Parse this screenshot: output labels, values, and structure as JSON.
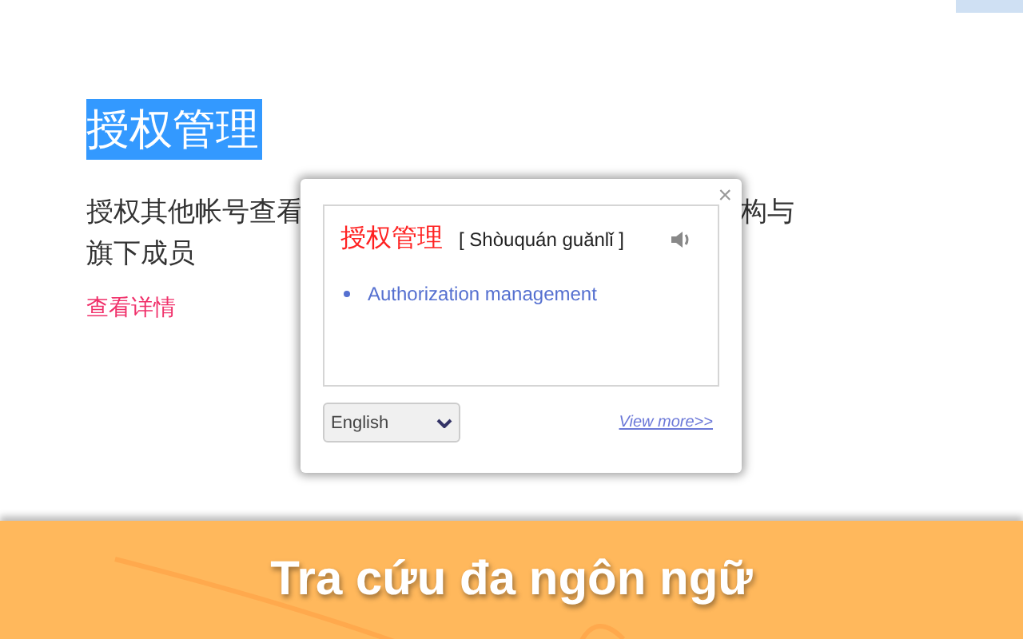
{
  "page": {
    "heading": "授权管理",
    "heading_selected": true,
    "paragraph_lines": [
      "授权其他帐号查看",
      "构与",
      "旗下成员"
    ],
    "link": "查看详情"
  },
  "popup": {
    "close": "×",
    "word": "授权管理",
    "pinyin": "[ Shòuquán guǎnlǐ ]",
    "meanings": [
      "Authorization management"
    ],
    "language": "English",
    "view_more": "View more>>"
  },
  "banner": {
    "title": "Tra cứu đa ngôn ngữ"
  }
}
